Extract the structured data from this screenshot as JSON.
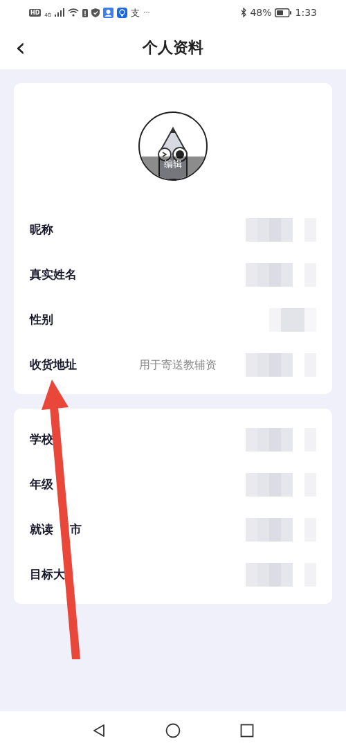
{
  "status_bar": {
    "left_badges": [
      "HD",
      "4G"
    ],
    "app_glyph": "支",
    "more": "···",
    "battery_percent": "48%",
    "time": "1:33"
  },
  "header": {
    "back": "‹",
    "title": "个人资料"
  },
  "avatar": {
    "edit_label": "编辑"
  },
  "sections": [
    {
      "rows": [
        {
          "label": "昵称",
          "kind": "blurred"
        },
        {
          "label": "真实姓名",
          "kind": "blurred"
        },
        {
          "label": "性别",
          "kind": "blurred_short"
        },
        {
          "label": "收货地址",
          "placeholder": "用于寄送教辅资",
          "kind": "blurred"
        }
      ]
    },
    {
      "rows": [
        {
          "label": "学校",
          "kind": "blurred"
        },
        {
          "label": "年级",
          "kind": "blurred"
        },
        {
          "label": "就读",
          "label_tail": "市",
          "kind": "blurred"
        },
        {
          "label": "目标大",
          "kind": "blurred"
        }
      ]
    }
  ],
  "annotation": {
    "kind": "arrow",
    "color": "#e8473a"
  }
}
